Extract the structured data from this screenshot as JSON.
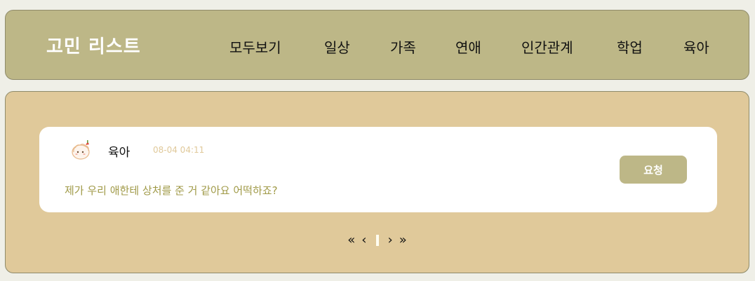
{
  "header": {
    "brand": "고민 리스트",
    "nav": [
      {
        "label": "모두보기"
      },
      {
        "label": "일상"
      },
      {
        "label": "가족"
      },
      {
        "label": "연애"
      },
      {
        "label": "인간관계"
      },
      {
        "label": "학업"
      },
      {
        "label": "육아"
      }
    ]
  },
  "posts": [
    {
      "avatar_icon": "cute-character-avatar-icon",
      "category": "육아",
      "timestamp": "08-04 04:11",
      "content": "제가 우리 애한테 상처를 준 거 같아요 어떡하죠?",
      "action_label": "요청"
    }
  ],
  "pagination": {
    "first": "«",
    "prev": "‹",
    "current": "1",
    "next": "›",
    "last": "»"
  },
  "colors": {
    "page_bg": "#efefe7",
    "navbar_bg": "#bdb787",
    "panel_bg": "#e0c99a",
    "card_bg": "#ffffff",
    "content_text": "#a09a48",
    "timestamp_text": "#e0c99a",
    "button_bg": "#bdb787"
  }
}
